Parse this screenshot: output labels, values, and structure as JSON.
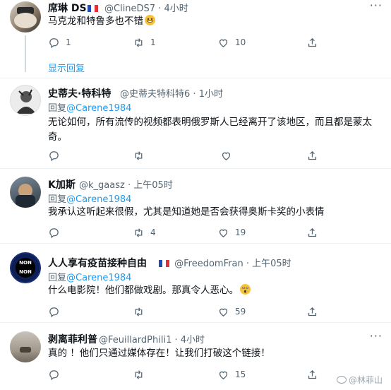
{
  "tweets": [
    {
      "name": "席琳 DS",
      "handle": "@ClineDS7",
      "time": "4小时",
      "text": "马克龙和特鲁多也不错",
      "reply": "1",
      "retweet": "1",
      "like": "10",
      "show_replies": "显示回复"
    },
    {
      "name": "史蒂夫·特科特",
      "handle": "@史蒂夫特科特6",
      "time": "1小时",
      "reply_prefix": "回复",
      "reply_to": "@Carene1984",
      "text": "无论如何，所有流传的视频都表明俄罗斯人已经离开了该地区，而且都是蒙太奇。",
      "reply": "",
      "retweet": "",
      "like": ""
    },
    {
      "name": "K加斯",
      "handle": "@k_gaasz",
      "time": "上午05时",
      "reply_prefix": "回复",
      "reply_to": "@Carene1984",
      "text": "我承认这听起来很假，尤其是知道她是否会获得奥斯卡奖的小表情",
      "reply": "",
      "retweet": "4",
      "like": "19"
    },
    {
      "name": "人人享有疫苗接种自由",
      "handle": "@FreedomFran",
      "time": "上午05时",
      "reply_prefix": "回复",
      "reply_to": "@Carene1984",
      "text": "什么电影院！他们都做戏剧。那真令人恶心。",
      "reply": "",
      "retweet": "",
      "like": "59"
    },
    {
      "name": "剥离菲利普",
      "handle": "@FeuillardPhili1",
      "time": "4小时",
      "text": "真的 ！他们只通过媒体存在！让我们打破这个链接！",
      "reply": "",
      "retweet": "",
      "like": "15"
    }
  ],
  "avatar_badge": {
    "line1": "NON",
    "line2": "NON"
  },
  "separator": "·",
  "watermark": "@林菲山",
  "icons": {
    "reply": "reply-icon",
    "retweet": "retweet-icon",
    "like": "heart-icon",
    "share": "share-icon",
    "more": "more-icon",
    "flag": "french-flag-icon",
    "emoji_grin": "grinning-emoji-icon",
    "emoji_shock": "astonished-emoji-icon"
  },
  "colors": {
    "accent": "#1d9bf0",
    "muted": "#536471",
    "text": "#0f1419"
  }
}
